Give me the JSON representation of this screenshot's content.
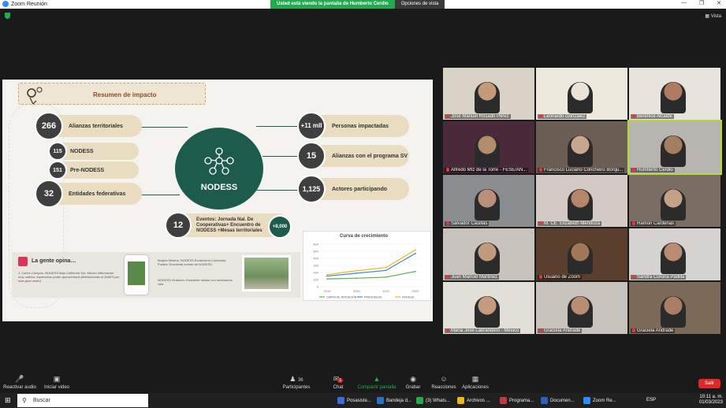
{
  "window": {
    "title": "Zoom Reunión",
    "share_banner": "Usted está viendo la pantalla de Humberto Cerdio",
    "view_options": "Opciones de vista",
    "view_label": "Vista"
  },
  "slide": {
    "header": "Resumen de impacto",
    "hub_label": "NODESS",
    "left_items": [
      {
        "value": "266",
        "label": "Alianzas territoriales"
      },
      {
        "value": "115",
        "label": "NODESS"
      },
      {
        "value": "151",
        "label": "Pre-NODESS"
      },
      {
        "value": "32",
        "label": "Entidades federativas"
      }
    ],
    "right_items": [
      {
        "value": "+11 mll",
        "label": "Personas impactadas"
      },
      {
        "value": "15",
        "label": "Alianzas con el programa SV"
      },
      {
        "value": "1,125",
        "label": "Actores participando"
      }
    ],
    "events": {
      "value": "12",
      "label": "Eventos: Jornada Nal. De Cooperativas+ Encuentro de NODESS +Mesas territoriales",
      "extra": "+8,000"
    },
    "opina": {
      "title": "La gente opina…",
      "quote1": "J. Carlos Campos, NODESS Baja California Sur: Mucha información muy valiosa, esperamos poder aprovecharla (felicitaciones al INAES por este gran vento)",
      "quote2": "Begina Medina, NODESS Ecoturismo Cuetzalan, Puebla: Excelente evento de NODESS",
      "quote3": "NODESS Zirahuén: Excelente sesión con sembrando vida"
    }
  },
  "chart_data": {
    "type": "line",
    "title": "Curva de crecimiento",
    "x": [
      "2019",
      "2020",
      "2021",
      "2022"
    ],
    "ylim": [
      0,
      600
    ],
    "yticks": [
      "0",
      "100",
      "200",
      "300",
      "400",
      "500",
      "600"
    ],
    "series": [
      {
        "name": "CARTA DE INTENCIÓN",
        "values": [
          110,
          120,
          135,
          215
        ],
        "color": "#5fb24a"
      },
      {
        "name": "PRENODESS",
        "values": [
          150,
          190,
          230,
          470
        ],
        "color": "#4a86c8"
      },
      {
        "name": "NODESS",
        "values": [
          170,
          225,
          270,
          520
        ],
        "color": "#e8b820"
      }
    ]
  },
  "participants": [
    {
      "name": "José Manuel Rosado Pérez",
      "color": "#d9d2c6",
      "skin": "#c49a7b"
    },
    {
      "name": "Leonardo Gonzalez",
      "color": "#ece8dc",
      "skin": "#e8e3d6"
    },
    {
      "name": "Berenice Alcalde",
      "color": "#e8e3dc",
      "skin": "#b07b60"
    },
    {
      "name": "Alfredo Mtz de la Torre - FESE/AN...",
      "color": "#4a2a3a",
      "skin": "#b38c6e"
    },
    {
      "name": "Francisco Luciano Concheiro Bórqu...",
      "color": "#6a5e55",
      "skin": "#c9a690"
    },
    {
      "name": "Humberto Cerdio",
      "color": "#b8b5b0",
      "skin": "#a57e62"
    },
    {
      "name": "Salvador Casillas",
      "color": "#8a8d8f",
      "skin": "#b89178"
    },
    {
      "name": "M. CE. Elizabeth Mendoza",
      "color": "#d2cbc5",
      "skin": "#b88468"
    },
    {
      "name": "Ramon Cardenas",
      "color": "#7a6d63",
      "skin": "#c4a28a"
    },
    {
      "name": "Juan Manuel Martinez",
      "color": "#c9c3bd",
      "skin": "#c29a7d"
    },
    {
      "name": "Usuario de Zoom",
      "color": "#5a3f2c",
      "skin": "#a07858"
    },
    {
      "name": "Sandra Corona Padilla",
      "color": "#d5d3d0",
      "skin": "#b98b70"
    },
    {
      "name": "María José Labrandero - México",
      "color": "#e2ded8",
      "skin": "#c49a80"
    },
    {
      "name": "Graciela Andrade",
      "color": "#c7c2bc",
      "skin": "#b88f73"
    },
    {
      "name": "Graciela Andrade",
      "color": "#7b6a58",
      "skin": "#a87f64"
    }
  ],
  "toolbar": {
    "mute": "Reactivar audio",
    "video": "Iniciar video",
    "participants": "Participantes",
    "participants_count": "36",
    "chat": "Chat",
    "chat_badge": "1",
    "share": "Compartir pantalla",
    "record": "Grabar",
    "reactions": "Reacciones",
    "apps": "Aplicaciones",
    "leave": "Salir"
  },
  "taskbar": {
    "search": "Buscar",
    "apps": [
      "Posasiste...",
      "Bandeja d...",
      "(3) Whats...",
      "Archivos ...",
      "Programa...",
      "Documen...",
      "Zoom Re..."
    ],
    "lang": "ESP",
    "time": "10:11 a. m.",
    "date": "01/03/2023"
  }
}
